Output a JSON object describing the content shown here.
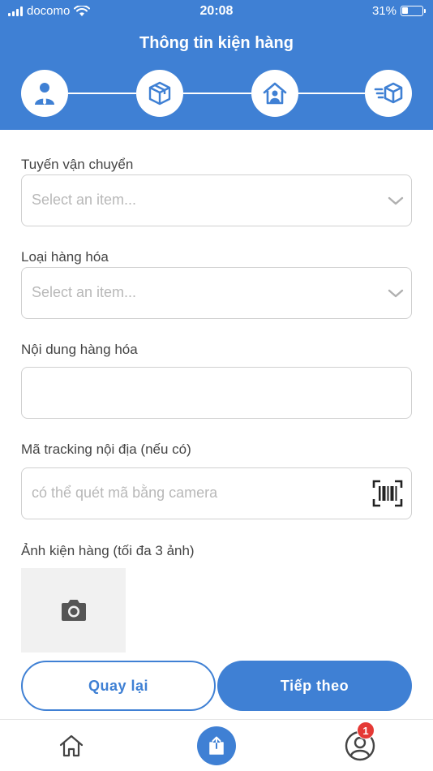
{
  "status_bar": {
    "carrier": "docomo",
    "time": "20:08",
    "battery_percent": "31%",
    "battery_level": 0.31
  },
  "header": {
    "title": "Thông tin kiện hàng",
    "steps": [
      {
        "icon": "user-icon",
        "state": "active"
      },
      {
        "icon": "package-icon",
        "state": "active"
      },
      {
        "icon": "home-user-icon",
        "state": "active"
      },
      {
        "icon": "fast-delivery-icon",
        "state": "outline"
      }
    ]
  },
  "form": {
    "route_label": "Tuyến vận chuyển",
    "route_placeholder": "Select an item...",
    "goods_type_label": "Loại hàng hóa",
    "goods_type_placeholder": "Select an item...",
    "content_label": "Nội dung hàng hóa",
    "content_value": "",
    "tracking_label": "Mã tracking nội địa (nếu có)",
    "tracking_placeholder": "có thể quét mã bằng camera",
    "photos_label": "Ảnh kiện hàng (tối đa 3 ảnh)"
  },
  "buttons": {
    "back": "Quay lại",
    "next": "Tiếp theo"
  },
  "tabbar": {
    "badge_count": "1"
  },
  "colors": {
    "primary": "#3f80d4",
    "badge": "#e53935",
    "border": "#d0d0d0",
    "placeholder": "#b8b8b8"
  }
}
